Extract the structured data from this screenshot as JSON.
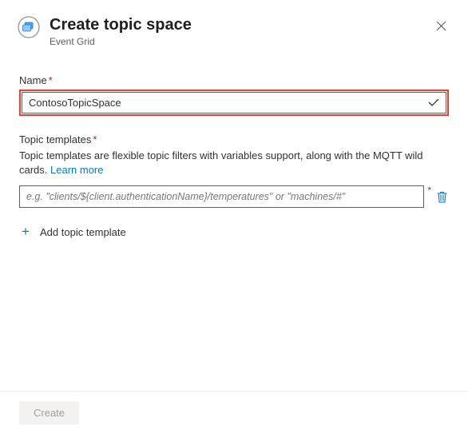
{
  "header": {
    "title": "Create topic space",
    "subtitle": "Event Grid"
  },
  "name_field": {
    "label": "Name",
    "value": "ContosoTopicSpace"
  },
  "templates_field": {
    "label": "Topic templates",
    "description_before": "Topic templates are flexible topic filters with variables support, along with the MQTT wild cards. ",
    "learn_more": "Learn more",
    "placeholder": "e.g. \"clients/${client.authenticationName}/temperatures\" or \"machines/#\"",
    "value": "",
    "add_label": "Add topic template"
  },
  "footer": {
    "create_label": "Create"
  }
}
